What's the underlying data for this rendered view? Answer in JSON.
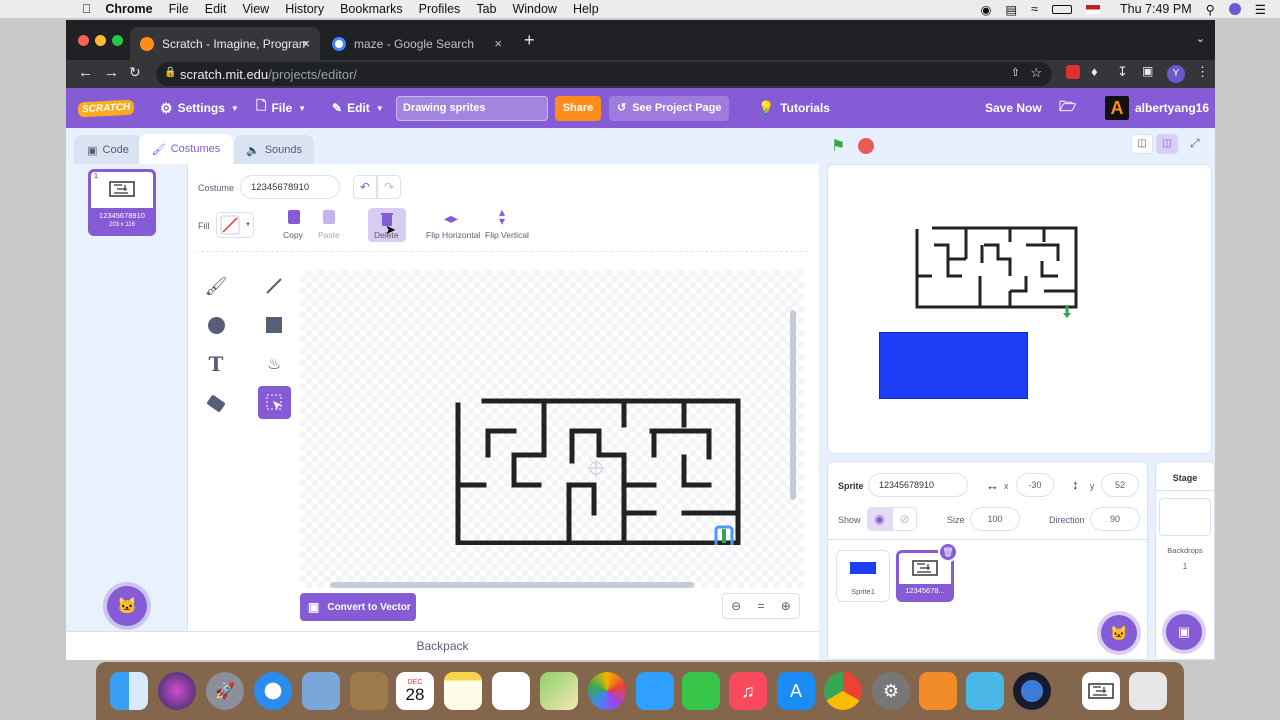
{
  "menubar": {
    "app": "Chrome",
    "items": [
      "File",
      "Edit",
      "View",
      "History",
      "Bookmarks",
      "Profiles",
      "Tab",
      "Window",
      "Help"
    ],
    "clock": "Thu 7:49 PM"
  },
  "browser": {
    "tabs": [
      {
        "title": "Scratch - Imagine, Program, S",
        "active": true
      },
      {
        "title": "maze - Google Search",
        "active": false
      }
    ],
    "new_tab": "+",
    "url_domain": "scratch.mit.edu",
    "url_path": "/projects/editor/",
    "profile_initial": "Y"
  },
  "scratch_menu": {
    "logo": "SCRATCH",
    "settings": "Settings",
    "file": "File",
    "edit": "Edit",
    "project_title": "Drawing sprites",
    "share": "Share",
    "see_project_page": "See Project Page",
    "tutorials": "Tutorials",
    "save_now": "Save Now",
    "username": "albertyang16",
    "avatar_letter": "A"
  },
  "editor_tabs": {
    "code": "Code",
    "costumes": "Costumes",
    "sounds": "Sounds"
  },
  "costume_list": [
    {
      "index": "1",
      "name": "12345678910",
      "size": "203 x 116"
    }
  ],
  "paint": {
    "costume_label": "Costume",
    "costume_name": "12345678910",
    "fill_label": "Fill",
    "copy": "Copy",
    "paste": "Paste",
    "delete": "Delete",
    "flip_h": "Flip Horizontal",
    "flip_v": "Flip Vertical",
    "convert": "Convert to Vector",
    "zoom_reset": "="
  },
  "backpack": "Backpack",
  "sprite_info": {
    "sprite_label": "Sprite",
    "sprite_name": "12345678910",
    "x_label": "x",
    "x": "-30",
    "y_label": "y",
    "y": "52",
    "show_label": "Show",
    "size_label": "Size",
    "size": "100",
    "direction_label": "Direction",
    "direction": "90"
  },
  "sprites": [
    {
      "name": "Sprite1",
      "selected": false
    },
    {
      "name": "12345678...",
      "selected": true
    }
  ],
  "stage_panel": {
    "title": "Stage",
    "backdrops_label": "Backdrops",
    "backdrops_count": "1"
  },
  "dock": {
    "calendar_month": "DEC",
    "calendar_day": "28"
  },
  "colors": {
    "accent": "#855cd6",
    "share": "#ff8c1a",
    "sprite_blue": "#1c3df5",
    "selected": "#4c97ff"
  }
}
